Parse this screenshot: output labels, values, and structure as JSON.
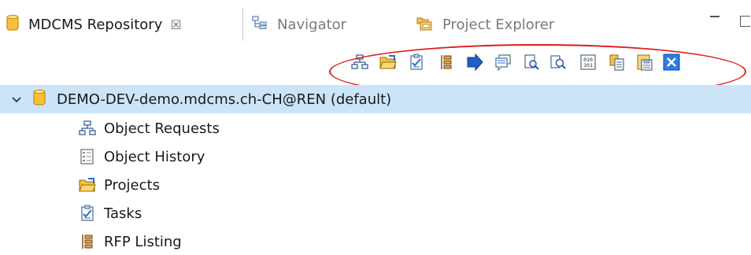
{
  "tabs": [
    {
      "label": "MDCMS Repository",
      "icon": "database-icon",
      "active": true,
      "close": "☒"
    },
    {
      "label": "Navigator",
      "icon": "navigator-icon",
      "active": false
    },
    {
      "label": "Project Explorer",
      "icon": "project-explorer-icon",
      "active": false
    }
  ],
  "toolbar": {
    "buttons": [
      "object-requests-icon",
      "projects-folder-icon",
      "tasks-icon",
      "rfp-listing-icon",
      "forward-arrow-icon",
      "comment-icon",
      "search-document-icon",
      "find-icon",
      "binary-icon",
      "copy-documents-icon",
      "save-document-icon",
      "close-x-icon"
    ],
    "highlight_color": "#e01b1b"
  },
  "tree": {
    "root": {
      "label": "DEMO-DEV-demo.mdcms.ch-CH@REN (default)",
      "expanded": true
    },
    "items": [
      {
        "label": "Object Requests",
        "icon": "object-requests-icon"
      },
      {
        "label": "Object History",
        "icon": "object-history-icon"
      },
      {
        "label": "Projects",
        "icon": "projects-folder-icon"
      },
      {
        "label": "Tasks",
        "icon": "tasks-icon"
      },
      {
        "label": "RFP Listing",
        "icon": "rfp-listing-icon"
      }
    ]
  },
  "colors": {
    "selection": "#cce4f7",
    "database_icon": "#f2b30f",
    "accent_blue": "#1f6fd0"
  }
}
